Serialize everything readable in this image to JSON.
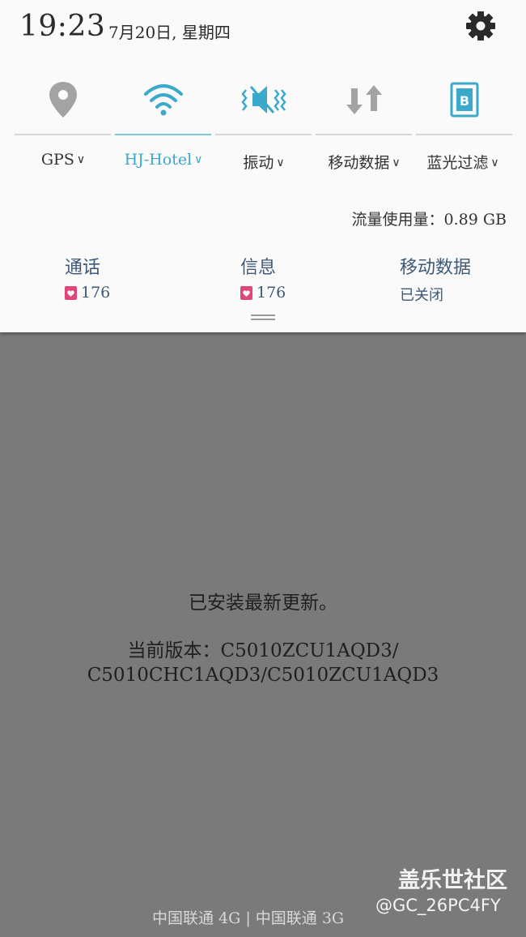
{
  "status": {
    "time": "19:23",
    "date": "7月20日, 星期四"
  },
  "colors": {
    "active": "#3aa9cb",
    "inactive": "#9e9e9e",
    "accent_pink": "#e0457b"
  },
  "quick_settings": [
    {
      "label": "GPS",
      "icon": "location-icon",
      "active": false
    },
    {
      "label": "HJ-Hotel",
      "icon": "wifi-icon",
      "active": true
    },
    {
      "label": "振动",
      "icon": "vibrate-icon",
      "active": true
    },
    {
      "label": "移动数据",
      "icon": "mobile-data-icon",
      "active": false
    },
    {
      "label": "蓝光过滤",
      "icon": "blue-light-filter-icon",
      "active": true
    }
  ],
  "caret": "∨",
  "data_usage": "流量使用量：0.89 GB",
  "stats": [
    {
      "title": "通话",
      "value": "176"
    },
    {
      "title": "信息",
      "value": "176"
    },
    {
      "title": "移动数据",
      "value": "已关闭"
    }
  ],
  "message": {
    "line1": "已安装最新更新。",
    "line2": "当前版本：C5010ZCU1AQD3/",
    "line3": "C5010CHC1AQD3/C5010ZCU1AQD3"
  },
  "carrier": "中国联通 4G | 中国联通 3G",
  "watermark": {
    "line1": "盖乐世社区",
    "line2": "@GC_26PC4FY"
  }
}
